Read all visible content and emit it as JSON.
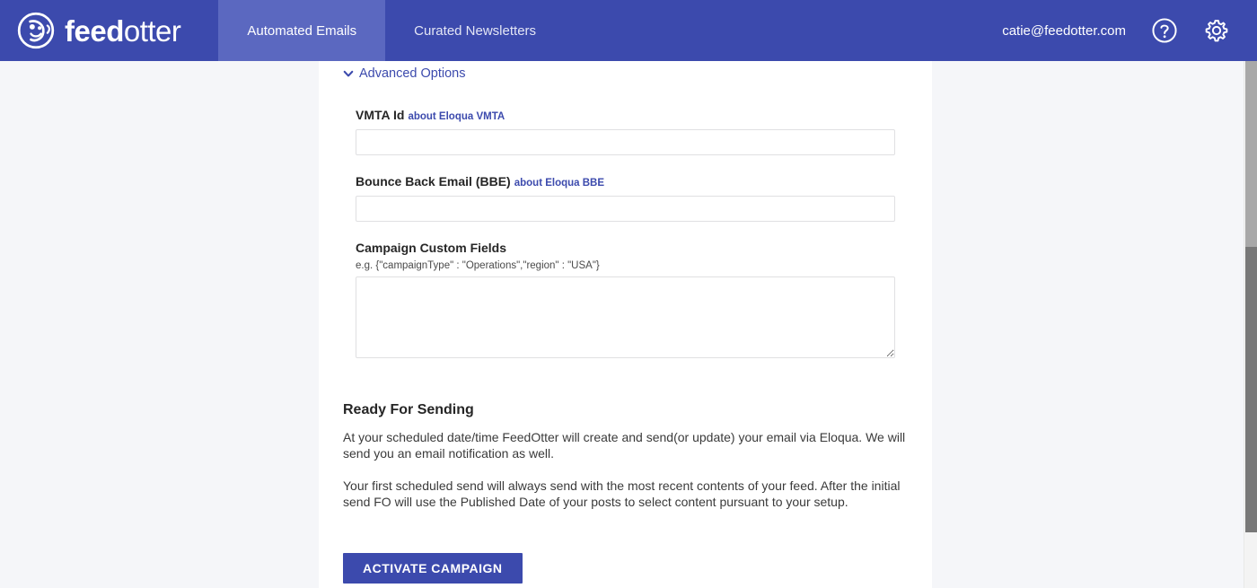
{
  "header": {
    "brand": {
      "logo_icon": "otter-circle-logo",
      "name_bold": "feed",
      "name_light": "otter"
    },
    "tabs": [
      {
        "label": "Automated Emails",
        "active": true
      },
      {
        "label": "Curated Newsletters",
        "active": false
      }
    ],
    "user_email": "catie@feedotter.com",
    "help_icon": "question-circle-icon",
    "settings_icon": "gear-icon",
    "background_color": "#3c4aad",
    "active_tab_color": "#5b68c0"
  },
  "form": {
    "advanced_options_label": "Advanced Options",
    "advanced_options_icon": "chevron-down-icon",
    "vmta": {
      "label": "VMTA Id",
      "helper_link": "about Eloqua VMTA",
      "value": "",
      "placeholder": ""
    },
    "bbe": {
      "label": "Bounce Back Email (BBE)",
      "helper_link": "about Eloqua BBE",
      "value": "",
      "placeholder": ""
    },
    "custom_fields": {
      "label": "Campaign Custom Fields",
      "hint": "e.g. {\"campaignType\" : \"Operations\",\"region\" : \"USA\"}",
      "value": "",
      "placeholder": ""
    }
  },
  "ready_section": {
    "title": "Ready For Sending",
    "paragraph_1": "At your scheduled date/time FeedOtter will create and send(or update) your email via Eloqua. We will send you an email notification as well.",
    "paragraph_2": "Your first scheduled send will always send with the most recent contents of your feed. After the initial send FO will use the Published Date of your posts to select content pursuant to your setup."
  },
  "cta": {
    "activate_label": "ACTIVATE CAMPAIGN",
    "color": "#3c4aad"
  },
  "colors": {
    "page_background": "#f5f6f9",
    "panel_background": "#ffffff",
    "link": "#3c4aad",
    "input_border": "#e0e0e2"
  }
}
